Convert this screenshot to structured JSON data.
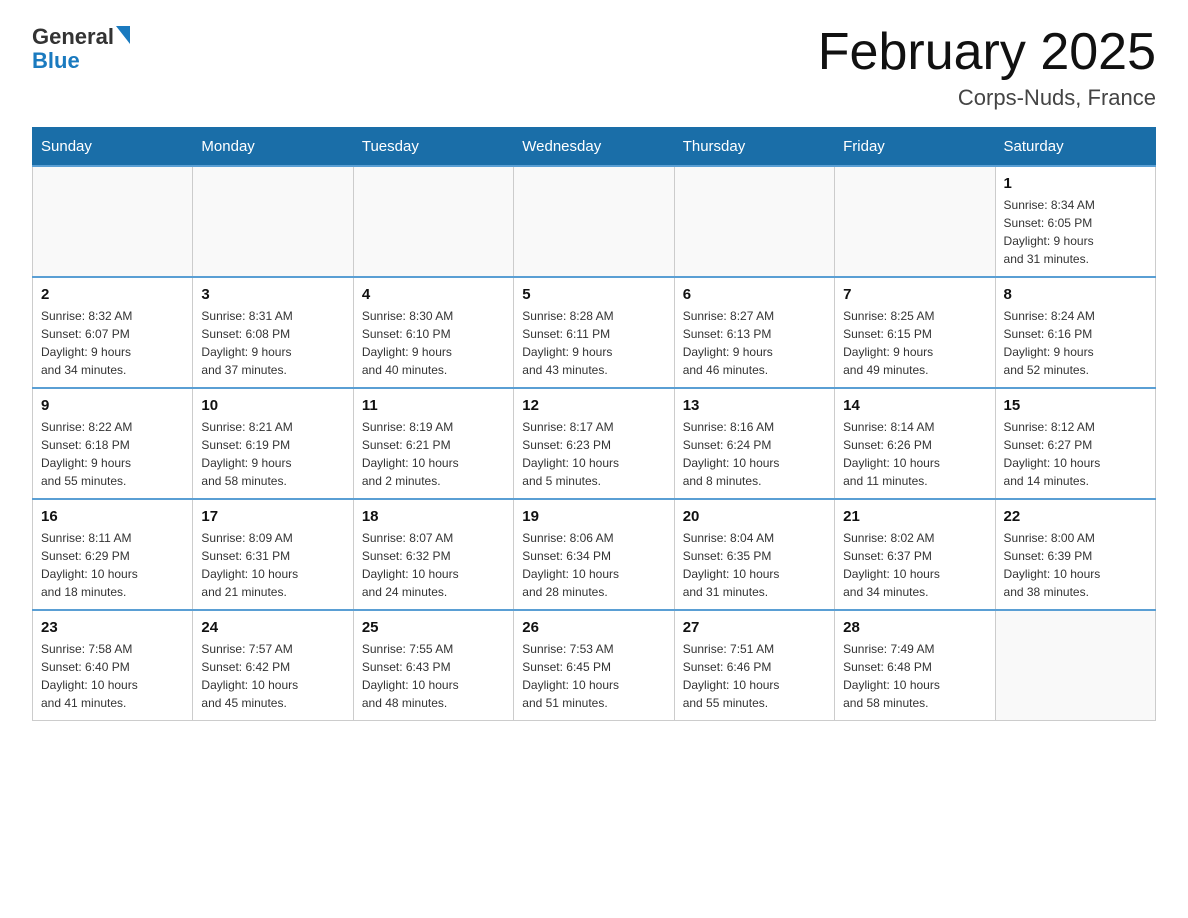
{
  "header": {
    "logo_general": "General",
    "logo_blue": "Blue",
    "title": "February 2025",
    "subtitle": "Corps-Nuds, France"
  },
  "weekdays": [
    "Sunday",
    "Monday",
    "Tuesday",
    "Wednesday",
    "Thursday",
    "Friday",
    "Saturday"
  ],
  "weeks": [
    [
      {
        "day": "",
        "info": ""
      },
      {
        "day": "",
        "info": ""
      },
      {
        "day": "",
        "info": ""
      },
      {
        "day": "",
        "info": ""
      },
      {
        "day": "",
        "info": ""
      },
      {
        "day": "",
        "info": ""
      },
      {
        "day": "1",
        "info": "Sunrise: 8:34 AM\nSunset: 6:05 PM\nDaylight: 9 hours\nand 31 minutes."
      }
    ],
    [
      {
        "day": "2",
        "info": "Sunrise: 8:32 AM\nSunset: 6:07 PM\nDaylight: 9 hours\nand 34 minutes."
      },
      {
        "day": "3",
        "info": "Sunrise: 8:31 AM\nSunset: 6:08 PM\nDaylight: 9 hours\nand 37 minutes."
      },
      {
        "day": "4",
        "info": "Sunrise: 8:30 AM\nSunset: 6:10 PM\nDaylight: 9 hours\nand 40 minutes."
      },
      {
        "day": "5",
        "info": "Sunrise: 8:28 AM\nSunset: 6:11 PM\nDaylight: 9 hours\nand 43 minutes."
      },
      {
        "day": "6",
        "info": "Sunrise: 8:27 AM\nSunset: 6:13 PM\nDaylight: 9 hours\nand 46 minutes."
      },
      {
        "day": "7",
        "info": "Sunrise: 8:25 AM\nSunset: 6:15 PM\nDaylight: 9 hours\nand 49 minutes."
      },
      {
        "day": "8",
        "info": "Sunrise: 8:24 AM\nSunset: 6:16 PM\nDaylight: 9 hours\nand 52 minutes."
      }
    ],
    [
      {
        "day": "9",
        "info": "Sunrise: 8:22 AM\nSunset: 6:18 PM\nDaylight: 9 hours\nand 55 minutes."
      },
      {
        "day": "10",
        "info": "Sunrise: 8:21 AM\nSunset: 6:19 PM\nDaylight: 9 hours\nand 58 minutes."
      },
      {
        "day": "11",
        "info": "Sunrise: 8:19 AM\nSunset: 6:21 PM\nDaylight: 10 hours\nand 2 minutes."
      },
      {
        "day": "12",
        "info": "Sunrise: 8:17 AM\nSunset: 6:23 PM\nDaylight: 10 hours\nand 5 minutes."
      },
      {
        "day": "13",
        "info": "Sunrise: 8:16 AM\nSunset: 6:24 PM\nDaylight: 10 hours\nand 8 minutes."
      },
      {
        "day": "14",
        "info": "Sunrise: 8:14 AM\nSunset: 6:26 PM\nDaylight: 10 hours\nand 11 minutes."
      },
      {
        "day": "15",
        "info": "Sunrise: 8:12 AM\nSunset: 6:27 PM\nDaylight: 10 hours\nand 14 minutes."
      }
    ],
    [
      {
        "day": "16",
        "info": "Sunrise: 8:11 AM\nSunset: 6:29 PM\nDaylight: 10 hours\nand 18 minutes."
      },
      {
        "day": "17",
        "info": "Sunrise: 8:09 AM\nSunset: 6:31 PM\nDaylight: 10 hours\nand 21 minutes."
      },
      {
        "day": "18",
        "info": "Sunrise: 8:07 AM\nSunset: 6:32 PM\nDaylight: 10 hours\nand 24 minutes."
      },
      {
        "day": "19",
        "info": "Sunrise: 8:06 AM\nSunset: 6:34 PM\nDaylight: 10 hours\nand 28 minutes."
      },
      {
        "day": "20",
        "info": "Sunrise: 8:04 AM\nSunset: 6:35 PM\nDaylight: 10 hours\nand 31 minutes."
      },
      {
        "day": "21",
        "info": "Sunrise: 8:02 AM\nSunset: 6:37 PM\nDaylight: 10 hours\nand 34 minutes."
      },
      {
        "day": "22",
        "info": "Sunrise: 8:00 AM\nSunset: 6:39 PM\nDaylight: 10 hours\nand 38 minutes."
      }
    ],
    [
      {
        "day": "23",
        "info": "Sunrise: 7:58 AM\nSunset: 6:40 PM\nDaylight: 10 hours\nand 41 minutes."
      },
      {
        "day": "24",
        "info": "Sunrise: 7:57 AM\nSunset: 6:42 PM\nDaylight: 10 hours\nand 45 minutes."
      },
      {
        "day": "25",
        "info": "Sunrise: 7:55 AM\nSunset: 6:43 PM\nDaylight: 10 hours\nand 48 minutes."
      },
      {
        "day": "26",
        "info": "Sunrise: 7:53 AM\nSunset: 6:45 PM\nDaylight: 10 hours\nand 51 minutes."
      },
      {
        "day": "27",
        "info": "Sunrise: 7:51 AM\nSunset: 6:46 PM\nDaylight: 10 hours\nand 55 minutes."
      },
      {
        "day": "28",
        "info": "Sunrise: 7:49 AM\nSunset: 6:48 PM\nDaylight: 10 hours\nand 58 minutes."
      },
      {
        "day": "",
        "info": ""
      }
    ]
  ]
}
